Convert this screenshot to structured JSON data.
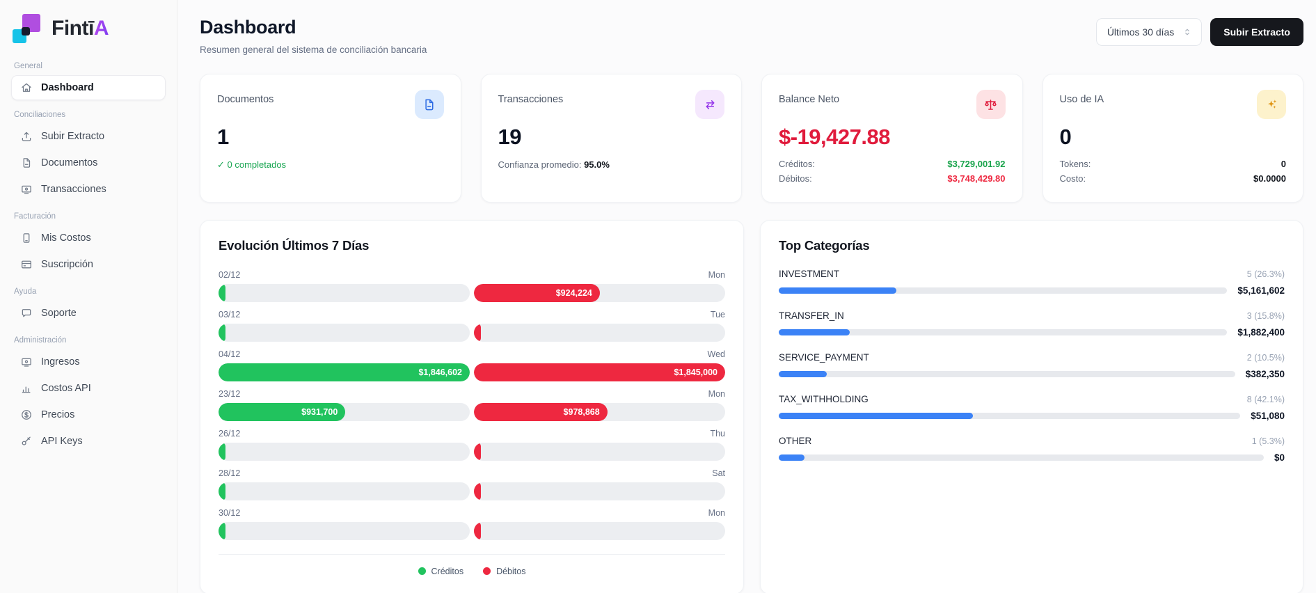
{
  "brand": {
    "name_dark": "Fintī",
    "name_accent": "A"
  },
  "colors": {
    "green": "#21c35e",
    "red": "#ee2840",
    "blue": "#3b82f6",
    "purple": "#9333ea",
    "amber": "#df9413"
  },
  "sidebar": {
    "sections": [
      {
        "label": "General",
        "items": [
          {
            "icon": "home-icon",
            "label": "Dashboard",
            "tone": "active"
          }
        ]
      },
      {
        "label": "Conciliaciones",
        "items": [
          {
            "icon": "upload-icon",
            "label": "Subir Extracto"
          },
          {
            "icon": "document-icon",
            "label": "Documentos"
          },
          {
            "icon": "transactions-icon",
            "label": "Transacciones"
          }
        ]
      },
      {
        "label": "Facturación",
        "items": [
          {
            "icon": "receipt-icon",
            "label": "Mis Costos"
          },
          {
            "icon": "credit-card-icon",
            "label": "Suscripción"
          }
        ]
      },
      {
        "label": "Ayuda",
        "items": [
          {
            "icon": "chat-icon",
            "label": "Soporte"
          }
        ]
      },
      {
        "label": "Administración",
        "items": [
          {
            "icon": "screen-icon",
            "label": "Ingresos"
          },
          {
            "icon": "bar-chart-icon",
            "label": "Costos API"
          },
          {
            "icon": "dollar-icon",
            "label": "Precios"
          },
          {
            "icon": "key-icon",
            "label": "API Keys"
          }
        ]
      }
    ]
  },
  "header": {
    "title": "Dashboard",
    "subtitle": "Resumen general del sistema de conciliación bancaria",
    "range_label": "Últimos 30 días",
    "upload_label": "Subir Extracto"
  },
  "stats": [
    {
      "title": "Documentos",
      "icon": "file-icon",
      "tone": "blue",
      "value": "1",
      "note": {
        "text": "✓ 0 completados",
        "strong": "",
        "tone": "green"
      },
      "rows": []
    },
    {
      "title": "Transacciones",
      "icon": "swap-icon",
      "tone": "purple",
      "value": "19",
      "note": {
        "text": "Confianza promedio: ",
        "strong": "95.0%",
        "tone": "gray"
      },
      "rows": []
    },
    {
      "title": "Balance Neto",
      "icon": "scale-icon",
      "tone": "red",
      "value": "$-19,427.88",
      "value_tone": "red",
      "rows": [
        {
          "label": "Créditos:",
          "value": "$3,729,001.92",
          "tone": "green"
        },
        {
          "label": "Débitos:",
          "value": "$3,748,429.80",
          "tone": "red"
        }
      ]
    },
    {
      "title": "Uso de IA",
      "icon": "sparkles-icon",
      "tone": "amber",
      "value": "0",
      "rows": [
        {
          "label": "Tokens:",
          "value": "0",
          "tone": "dark"
        },
        {
          "label": "Costo:",
          "value": "$0.0000",
          "tone": "dark"
        }
      ]
    }
  ],
  "evolution": {
    "title": "Evolución Últimos 7 Días",
    "rows": [
      {
        "date": "02/12",
        "day": "Mon",
        "credit_pct": 0,
        "debit_pct": 50.1,
        "credit_label": "",
        "debit_label": "$924,224"
      },
      {
        "date": "03/12",
        "day": "Tue",
        "credit_pct": 0,
        "debit_pct": 0,
        "credit_label": "",
        "debit_label": ""
      },
      {
        "date": "04/12",
        "day": "Wed",
        "credit_pct": 100,
        "debit_pct": 100,
        "credit_label": "$1,846,602",
        "debit_label": "$1,845,000"
      },
      {
        "date": "23/12",
        "day": "Mon",
        "credit_pct": 50.5,
        "debit_pct": 53.1,
        "credit_label": "$931,700",
        "debit_label": "$978,868"
      },
      {
        "date": "26/12",
        "day": "Thu",
        "credit_pct": 0,
        "debit_pct": 0,
        "credit_label": "",
        "debit_label": ""
      },
      {
        "date": "28/12",
        "day": "Sat",
        "credit_pct": 0,
        "debit_pct": 0,
        "credit_label": "",
        "debit_label": ""
      },
      {
        "date": "30/12",
        "day": "Mon",
        "credit_pct": 0,
        "debit_pct": 0,
        "credit_label": "",
        "debit_label": ""
      }
    ],
    "legend": [
      {
        "label": "Créditos",
        "tone": "green"
      },
      {
        "label": "Débitos",
        "tone": "red"
      }
    ]
  },
  "categories": {
    "title": "Top Categorías",
    "items": [
      {
        "name": "INVESTMENT",
        "count": "5 (26.3%)",
        "pct": 26.3,
        "amount": "$5,161,602"
      },
      {
        "name": "TRANSFER_IN",
        "count": "3 (15.8%)",
        "pct": 15.8,
        "amount": "$1,882,400"
      },
      {
        "name": "SERVICE_PAYMENT",
        "count": "2 (10.5%)",
        "pct": 10.5,
        "amount": "$382,350"
      },
      {
        "name": "TAX_WITHHOLDING",
        "count": "8 (42.1%)",
        "pct": 42.1,
        "amount": "$51,080"
      },
      {
        "name": "OTHER",
        "count": "1 (5.3%)",
        "pct": 5.3,
        "amount": "$0"
      }
    ]
  }
}
